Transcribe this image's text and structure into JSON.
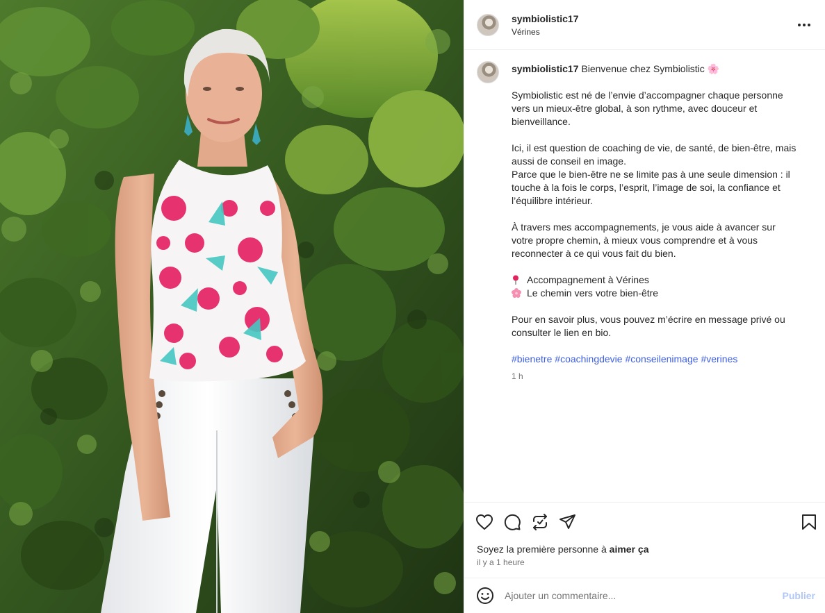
{
  "post": {
    "username": "symbiolistic17",
    "location": "Vérines",
    "photo_alt": "Femme aux cheveux courts gris en haut fleuri rose et pantalon blanc devant une haie de lierre"
  },
  "caption": {
    "username": "symbiolistic17",
    "first_line": "Bienvenue chez Symbiolistic 🌸",
    "paragraphs": [
      "Symbiolistic est né de l’envie d’accompagner chaque personne vers un mieux-être global, à son rythme, avec douceur et bienveillance.",
      "Ici, il est question de coaching de vie, de santé, de bien-être, mais aussi de conseil en image.",
      "Parce que le bien-être ne se limite pas à une seule dimension : il touche à la fois le corps, l’esprit, l’image de soi, la confiance et l’équilibre intérieur.",
      "À travers mes accompagnements, je vous aide à avancer sur votre propre chemin, à mieux vous comprendre et à vous reconnecter à ce qui vous fait du bien."
    ],
    "bullet_1": "Accompagnement à Vérines",
    "bullet_2": "Le chemin vers votre bien-être",
    "closing": "Pour en savoir plus, vous pouvez m’écrire en message privé ou consulter le lien en bio.",
    "hashtags": [
      "#bienetre",
      "#coachingdevie",
      "#conseilenimage",
      "#verines"
    ],
    "time": "1 h"
  },
  "actions": {
    "like_icon": "heart-icon",
    "comment_icon": "comment-icon",
    "share_icon": "repost-icon",
    "send_icon": "send-icon",
    "save_icon": "bookmark-icon"
  },
  "likes": {
    "prefix": "Soyez la première personne à ",
    "bold": "aimer ça"
  },
  "posted_ago": "il y a 1 heure",
  "comment": {
    "placeholder": "Ajouter un commentaire...",
    "publish_label": "Publier"
  },
  "colors": {
    "link_blue": "#3d5ee0",
    "publish_disabled": "#b2c7f5",
    "muted": "#737373"
  }
}
